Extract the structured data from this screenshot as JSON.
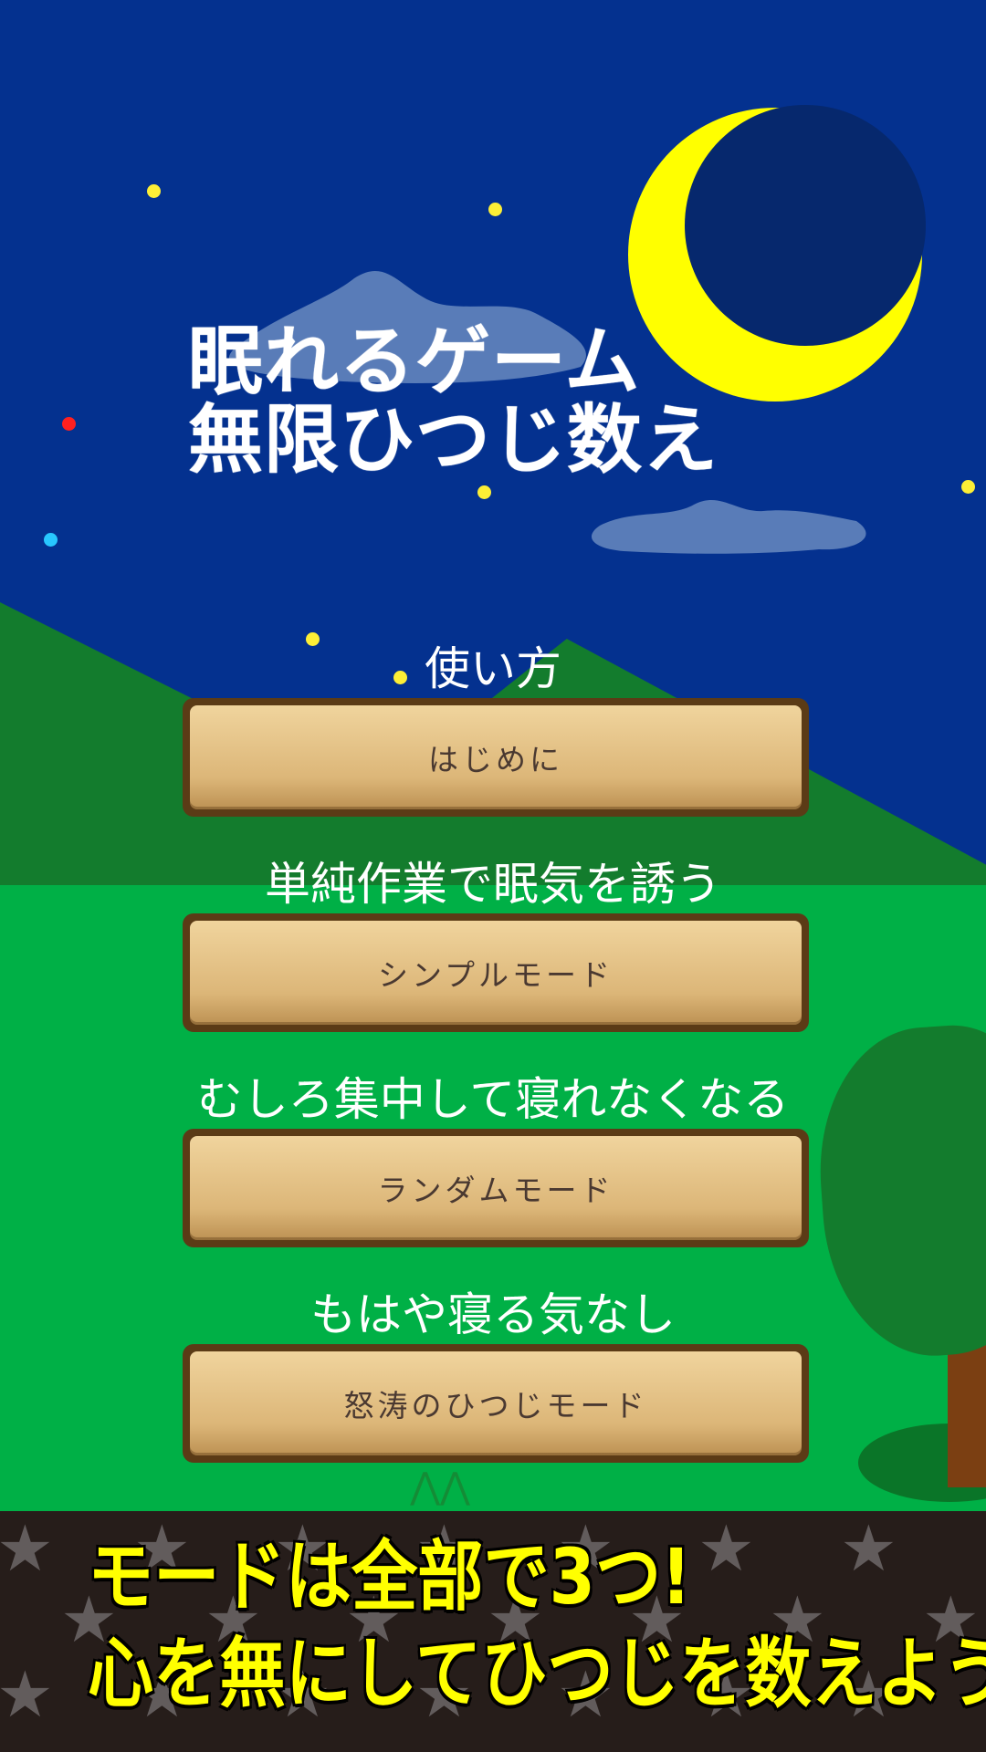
{
  "title": {
    "line1": "眠れるゲーム",
    "line2": "無限ひつじ数え"
  },
  "menu": [
    {
      "caption": "使い方",
      "button": "はじめに"
    },
    {
      "caption": "単純作業で眠気を誘う",
      "button": "シンプルモード"
    },
    {
      "caption": "むしろ集中して寝れなくなる",
      "button": "ランダムモード"
    },
    {
      "caption": "もはや寝る気なし",
      "button": "怒涛のひつじモード"
    }
  ],
  "banner": {
    "line1": "モードは全部で3つ!",
    "line2": "心を無にしてひつじを数えよう!"
  },
  "colors": {
    "sky": "#04318f",
    "moon": "#ffff00",
    "button": "#e7c68a",
    "banner_text": "#ffff00"
  },
  "icons": {
    "moon": "crescent-moon",
    "tree": "tree",
    "banner_star": "star"
  }
}
